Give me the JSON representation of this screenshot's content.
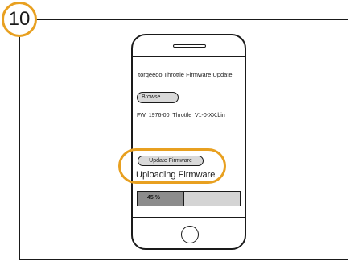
{
  "step": {
    "number": "10"
  },
  "app": {
    "title": "torqeedo Throttle Firmware Update",
    "browse_label": "Browse...",
    "file_name": "FW_1976-00_Throttle_V1-0-XX.bin",
    "update_label": "Update Firmware",
    "status_text": "Uploading Firmware",
    "progress": {
      "value": 0.45,
      "label": "45 %"
    }
  },
  "colors": {
    "highlight": "#e8a020",
    "progress_fill": "#8c8c8c",
    "progress_track": "#d4d4d4"
  }
}
